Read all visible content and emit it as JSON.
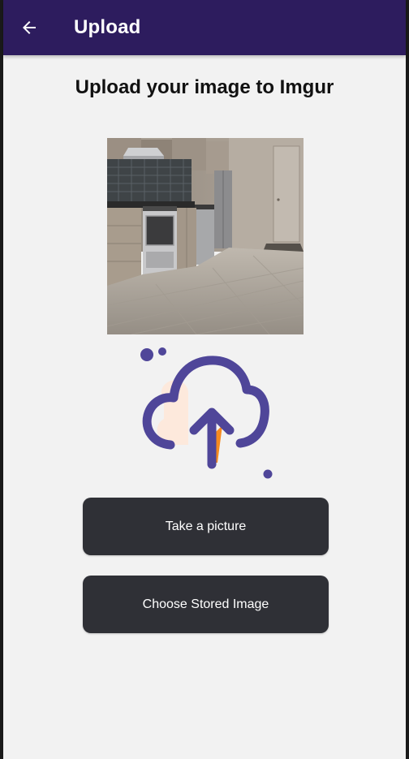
{
  "app_bar": {
    "title": "Upload",
    "back_icon": "arrow-left-icon",
    "background": "#2d1c5e"
  },
  "main": {
    "heading": "Upload your image to Imgur",
    "selected_image": "kitchen-photo",
    "illustration_icon": "cloud-upload-icon",
    "illustration_colors": {
      "outline": "#4f4699",
      "fill": "#fde9dc",
      "accent": "#f68a1f"
    }
  },
  "buttons": {
    "take_picture": "Take a picture",
    "choose_stored": "Choose Stored Image",
    "background": "#2f3036"
  }
}
